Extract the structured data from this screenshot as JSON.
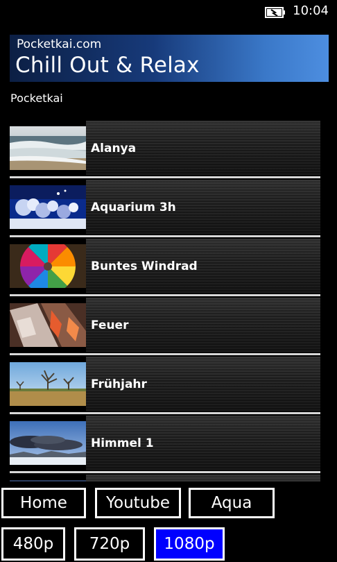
{
  "status_bar": {
    "time": "10:04",
    "battery_icon": "battery-charging-icon"
  },
  "header": {
    "site_name": "Pocketkai.com",
    "title": "Chill Out & Relax"
  },
  "subtitle": "Pocketkai",
  "videos": [
    {
      "label": "Alanya",
      "thumbnail": "beach-waves-thumbnail"
    },
    {
      "label": "Aquarium 3h",
      "thumbnail": "aquarium-coral-thumbnail"
    },
    {
      "label": "Buntes Windrad",
      "thumbnail": "pinwheel-thumbnail"
    },
    {
      "label": "Feuer",
      "thumbnail": "fire-thumbnail"
    },
    {
      "label": "Frühjahr",
      "thumbnail": "spring-landscape-thumbnail"
    },
    {
      "label": "Himmel 1",
      "thumbnail": "sky-clouds-thumbnail"
    }
  ],
  "nav_buttons": {
    "home": "Home",
    "youtube": "Youtube",
    "aqua": "Aqua"
  },
  "quality_buttons": {
    "q480": "480p",
    "q720": "720p",
    "q1080": "1080p",
    "selected": "1080p"
  },
  "colors": {
    "selected_button": "#0000ff",
    "header_gradient_end": "#4d8ee0"
  }
}
